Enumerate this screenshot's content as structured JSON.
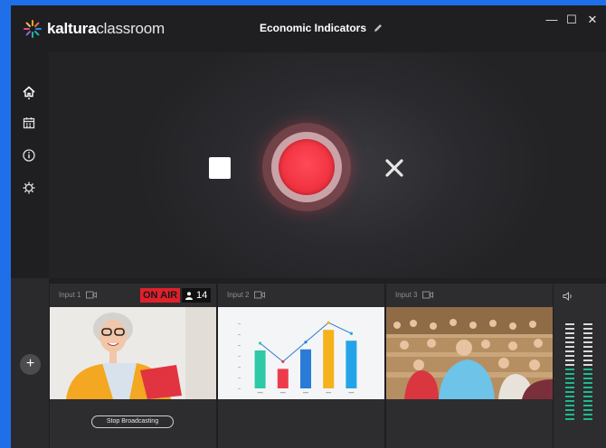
{
  "app": {
    "logo_bold": "kaltura",
    "logo_light": "classroom",
    "title": "Economic Indicators"
  },
  "window_controls": {
    "minimize": "—",
    "maximize": "☐",
    "close": "✕"
  },
  "sidebar": {
    "items": [
      {
        "name": "home-icon",
        "active": true
      },
      {
        "name": "calendar-icon"
      },
      {
        "name": "info-icon"
      },
      {
        "name": "settings-icon"
      }
    ]
  },
  "controls": {
    "stop": "stop",
    "record": "record",
    "cancel": "cancel"
  },
  "inputs": [
    {
      "label": "Input 1",
      "on_air": "ON AIR",
      "viewers": "14",
      "action": "Stop Broadcasting"
    },
    {
      "label": "Input 2"
    },
    {
      "label": "Input 3"
    }
  ],
  "add_button": "+",
  "colors": {
    "accent_red": "#f0313f",
    "on_air_bg": "#e0202c",
    "meter_green": "#1fb98f",
    "window_border": "#1e6fe8"
  },
  "chart_data": {
    "type": "bar",
    "categories": [
      "",
      "",
      "",
      "",
      ""
    ],
    "values": [
      3.5,
      1.8,
      3.6,
      5.4,
      4.4
    ],
    "colors": [
      "#2ec9a6",
      "#ee3b4b",
      "#2a7bd6",
      "#f5b21a",
      "#24a4e8"
    ],
    "ylim": [
      0,
      6
    ],
    "grid": false,
    "has_line_overlay": true
  }
}
